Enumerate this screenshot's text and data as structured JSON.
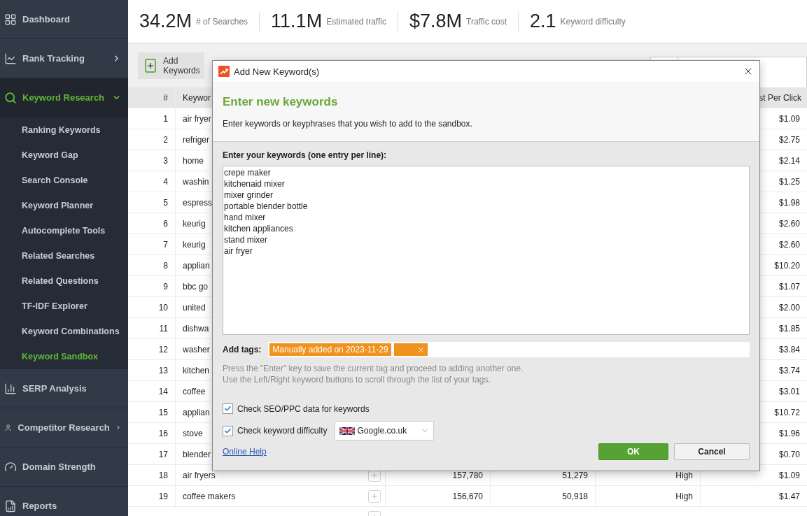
{
  "sidebar": {
    "items": [
      {
        "label": "Dashboard",
        "selected": false
      },
      {
        "label": "Rank Tracking",
        "expandable": true,
        "expanded": false,
        "selected": false
      },
      {
        "label": "Keyword Research",
        "expandable": true,
        "expanded": true,
        "selected": true,
        "children": [
          {
            "label": "Ranking Keywords",
            "selected": false
          },
          {
            "label": "Keyword Gap",
            "selected": false
          },
          {
            "label": "Search Console",
            "selected": false
          },
          {
            "label": "Keyword Planner",
            "selected": false
          },
          {
            "label": "Autocomplete Tools",
            "selected": false
          },
          {
            "label": "Related Searches",
            "selected": false
          },
          {
            "label": "Related Questions",
            "selected": false
          },
          {
            "label": "TF-IDF Explorer",
            "selected": false
          },
          {
            "label": "Keyword Combinations",
            "selected": false
          },
          {
            "label": "Keyword Sandbox",
            "selected": true
          }
        ]
      },
      {
        "label": "SERP Analysis",
        "selected": false
      },
      {
        "label": "Competitor Research",
        "expandable": true,
        "expanded": false,
        "selected": false
      },
      {
        "label": "Domain Strength",
        "selected": false
      },
      {
        "label": "Reports",
        "selected": false
      }
    ]
  },
  "stats": [
    {
      "value": "34.2M",
      "label": "# of Searches"
    },
    {
      "value": "11.1M",
      "label": "Estimated traffic"
    },
    {
      "value": "$7.8M",
      "label": "Traffic cost"
    },
    {
      "value": "2.1",
      "label": "Keyword difficulty"
    }
  ],
  "toolbar": {
    "add_button": "Add Keywords"
  },
  "table": {
    "columns": [
      "#",
      "Keywor",
      "st Per Click"
    ],
    "rows": [
      {
        "num": "1",
        "keyword": "air fryer",
        "cpc": "$1.09"
      },
      {
        "num": "2",
        "keyword": "refriger",
        "cpc": "$2.75"
      },
      {
        "num": "3",
        "keyword": "home",
        "cpc": "$2.14"
      },
      {
        "num": "4",
        "keyword": "washin",
        "cpc": "$1.25"
      },
      {
        "num": "5",
        "keyword": "espress",
        "cpc": "$1.98"
      },
      {
        "num": "6",
        "keyword": "keurig",
        "cpc": "$2.60"
      },
      {
        "num": "7",
        "keyword": "keurig",
        "cpc": "$2.60"
      },
      {
        "num": "8",
        "keyword": "applian",
        "cpc": "$10.20"
      },
      {
        "num": "9",
        "keyword": "bbc go",
        "cpc": "$1.07"
      },
      {
        "num": "10",
        "keyword": "united",
        "cpc": "$2.00"
      },
      {
        "num": "11",
        "keyword": "dishwa",
        "cpc": "$1.85"
      },
      {
        "num": "12",
        "keyword": "washer",
        "cpc": "$3.84"
      },
      {
        "num": "13",
        "keyword": "kitchen",
        "cpc": "$3.74"
      },
      {
        "num": "14",
        "keyword": "coffee",
        "cpc": "$3.01"
      },
      {
        "num": "15",
        "keyword": "applian",
        "cpc": "$10.72"
      },
      {
        "num": "16",
        "keyword": "stove",
        "cpc": "$1.96"
      },
      {
        "num": "17",
        "keyword": "blender",
        "cpc": "$0.70"
      },
      {
        "num": "18",
        "keyword": "air fryers",
        "searches": "157,780",
        "traffic": "51,279",
        "difficulty": "High",
        "cpc": "$1.09"
      },
      {
        "num": "19",
        "keyword": "coffee makers",
        "searches": "156,670",
        "traffic": "50,918",
        "difficulty": "High",
        "cpc": "$1.47"
      }
    ]
  },
  "dialog": {
    "title": "Add New Keyword(s)",
    "heading": "Enter new keywords",
    "description": "Enter keywords or keyphrases that you wish to add to the sandbox.",
    "keywords_label": "Enter your keywords (one entry per line):",
    "keywords": [
      "crepe maker",
      "kitchenaid mixer",
      "mixer grinder",
      "portable blender bottle",
      "hand mixer",
      "kitchen appliances",
      "stand mixer",
      "air fryer"
    ],
    "tags_label": "Add tags:",
    "tags": [
      {
        "kind": "tag",
        "text": "Manually added on 2023-11-29"
      },
      {
        "kind": "new"
      }
    ],
    "hint": [
      "Press the \"Enter\" key to save the current tag and proceed to adding another one.",
      "Use the Left/Right keyword buttons to scroll through the list of your tags."
    ],
    "options": [
      {
        "label": "Check SEO/PPC data for keywords",
        "checked": true
      },
      {
        "label": "Check keyword difficulty",
        "checked": true,
        "engine": "Google.co.uk"
      }
    ],
    "help_link": "Online Help",
    "ok": "OK",
    "cancel": "Cancel"
  }
}
